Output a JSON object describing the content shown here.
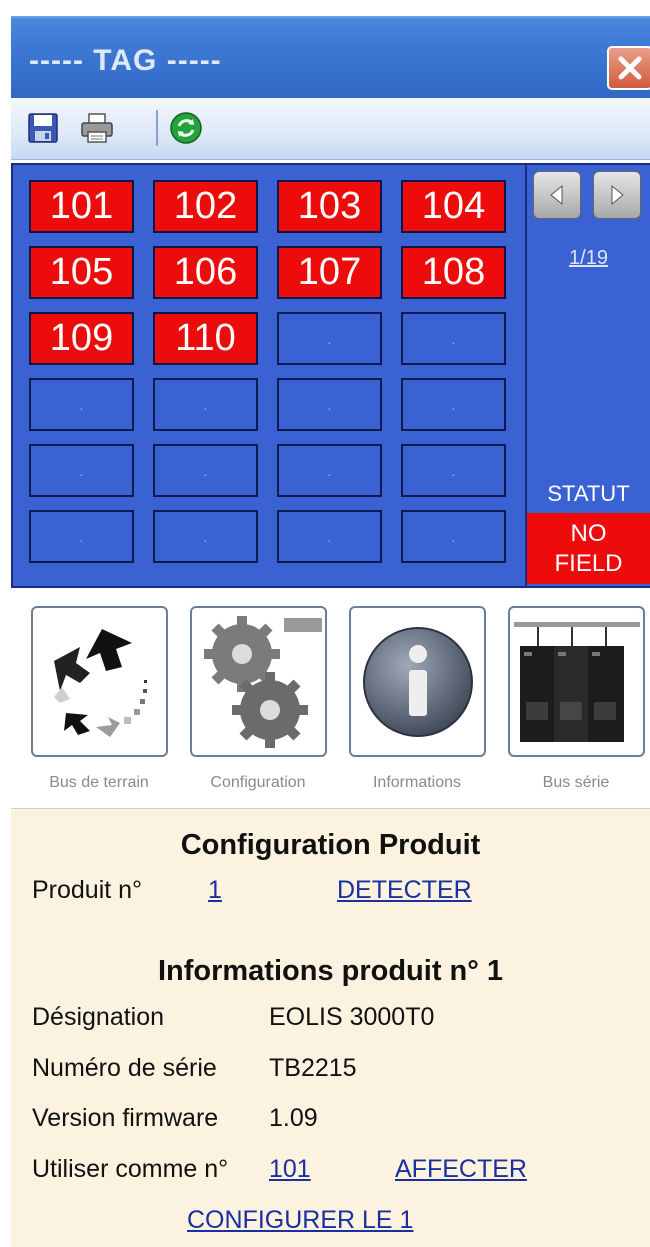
{
  "window": {
    "title": "----- TAG -----"
  },
  "toolbar": {
    "icons": [
      "save-icon",
      "print-icon",
      "refresh-icon"
    ]
  },
  "grid": {
    "tiles": [
      "101",
      "102",
      "103",
      "104",
      "105",
      "106",
      "107",
      "108",
      "109",
      "110",
      ".",
      ".",
      ".",
      ".",
      ".",
      ".",
      ".",
      ".",
      ".",
      ".",
      ".",
      ".",
      ".",
      "."
    ],
    "active_color": "#ee0b0b",
    "empty_color": "#3a62d2"
  },
  "pager": {
    "page": "1/19"
  },
  "status": {
    "label": "STATUT",
    "value_line1": "NO",
    "value_line2": "FIELD",
    "value_color": "#ee0b0b"
  },
  "modes": [
    {
      "label": "Bus de terrain",
      "icon": "fieldbus-arrows-icon"
    },
    {
      "label": "Configuration",
      "icon": "gears-icon"
    },
    {
      "label": "Informations",
      "icon": "info-icon"
    },
    {
      "label": "Bus série",
      "icon": "serial-bus-modules-icon"
    }
  ],
  "config": {
    "title": "Configuration Produit",
    "product_label": "Produit n°",
    "product_value": "1",
    "detect_link": "DETECTER"
  },
  "product_info": {
    "title": "Informations produit n° 1",
    "designation_label": "Désignation",
    "designation_value": "EOLIS 3000T0",
    "serial_label": "Numéro de série",
    "serial_value": "TB2215",
    "firmware_label": "Version firmware",
    "firmware_value": "1.09",
    "use_as_label": "Utiliser comme n°",
    "use_as_value": "101",
    "assign_link": "AFFECTER",
    "configure_link": "CONFIGURER LE 1"
  }
}
